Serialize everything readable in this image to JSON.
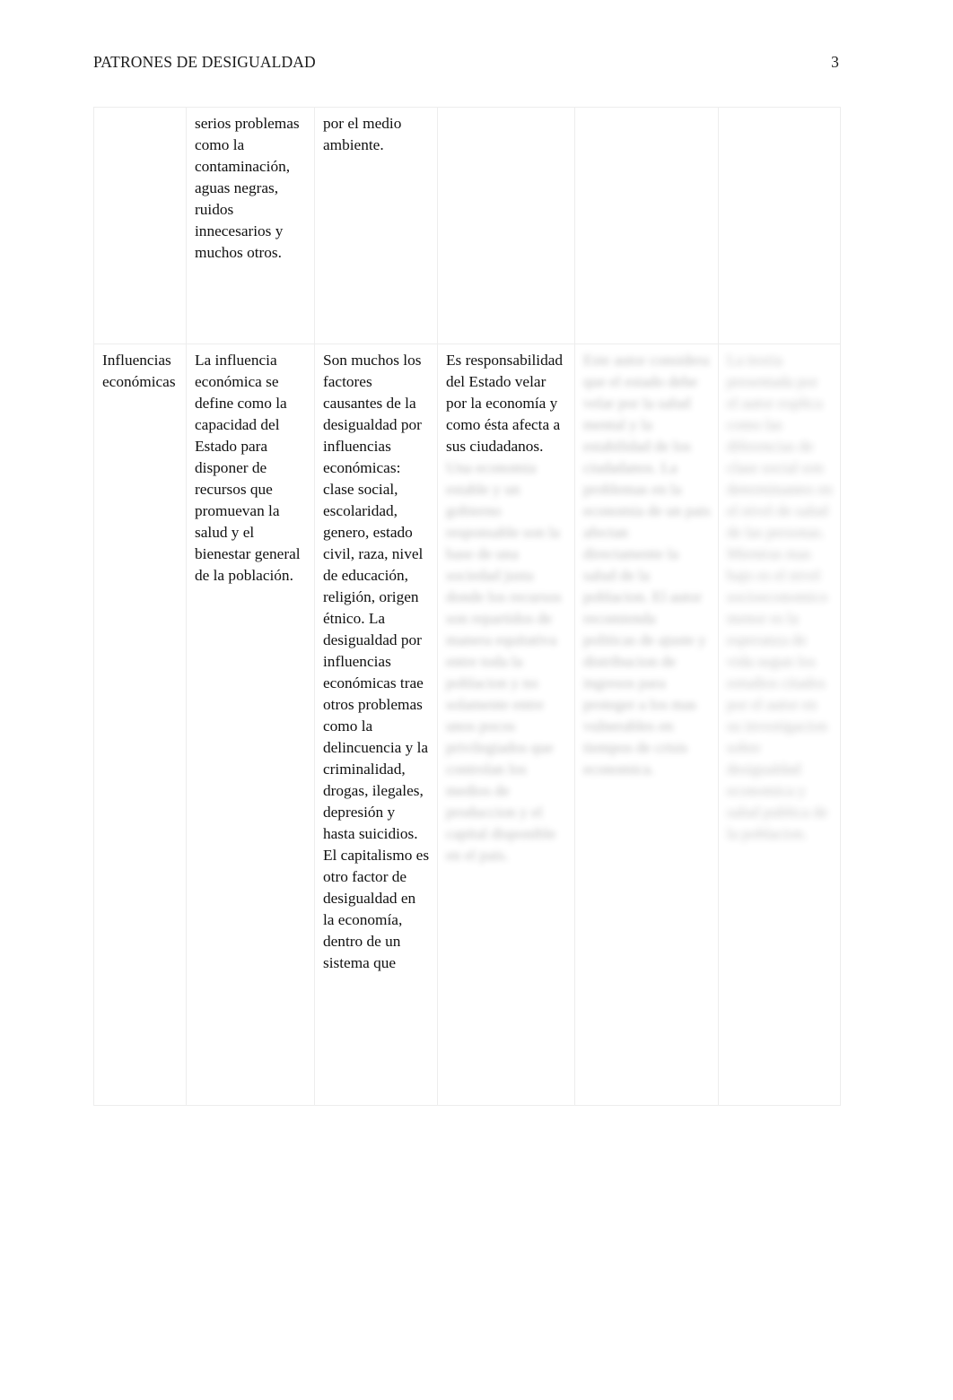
{
  "header": {
    "title": "PATRONES DE DESIGUALDAD",
    "page_number": "3"
  },
  "table": {
    "columns": 6,
    "rows": [
      {
        "name": "row-continuation",
        "cells": [
          "",
          "serios problemas como la contaminación, aguas negras, ruidos innecesarios y muchos otros.",
          "por el medio ambiente.",
          "",
          "",
          ""
        ]
      },
      {
        "name": "row-influencias-economicas",
        "cells": [
          "Influencias económicas",
          "La influencia económica se define como la capacidad del\nEstado para disponer de recursos que promuevan la salud y el bienestar general de la población.",
          "Son muchos los factores causantes de la desigualdad por influencias económicas: clase social, escolaridad, genero, estado civil, raza, nivel de educación, religión, origen étnico. La desigualdad por influencias económicas trae otros problemas como la delincuencia y la criminalidad, drogas, ilegales, depresión y hasta suicidios. El capitalismo es otro factor de desigualdad en la economía, dentro de un sistema que",
          "Es responsabilidad del Estado velar por la economía y como ésta afecta a sus ciudadanos.",
          "",
          ""
        ],
        "redacted_cells": {
          "col4": "Una economia estable y un gobierno responsable son la base de una sociedad justa donde los recursos son repartidos de manera equitativa entre toda la poblacion y no solamente entre unos pocos privilegiados que controlan los medios de produccion y el capital disponible en el pais.",
          "col5": "Este autor considera que el estado debe velar por la salud mental y la estabilidad de los ciudadanos. La problemas en la economia de un pais afectan directamente la salud de la poblacion. El autor recomienda politicas de ajuste y distribucion de ingresos para proteger a los mas vulnerables en tiempos de crisis economica.",
          "col6": "La teoria presentada por el autor explica como las diferencias de clase social son determinantes en el nivel de salud de las personas. Mientras mas bajo es el nivel socioeconomico menor es la esperanza de vida segun los estudios citados por el autor en su investigacion sobre desigualdad economica y salud publica de la poblacion."
        }
      }
    ]
  },
  "styles": {
    "page_background": "#ffffff",
    "text_color": "#111111",
    "border_color": "#ededed"
  }
}
